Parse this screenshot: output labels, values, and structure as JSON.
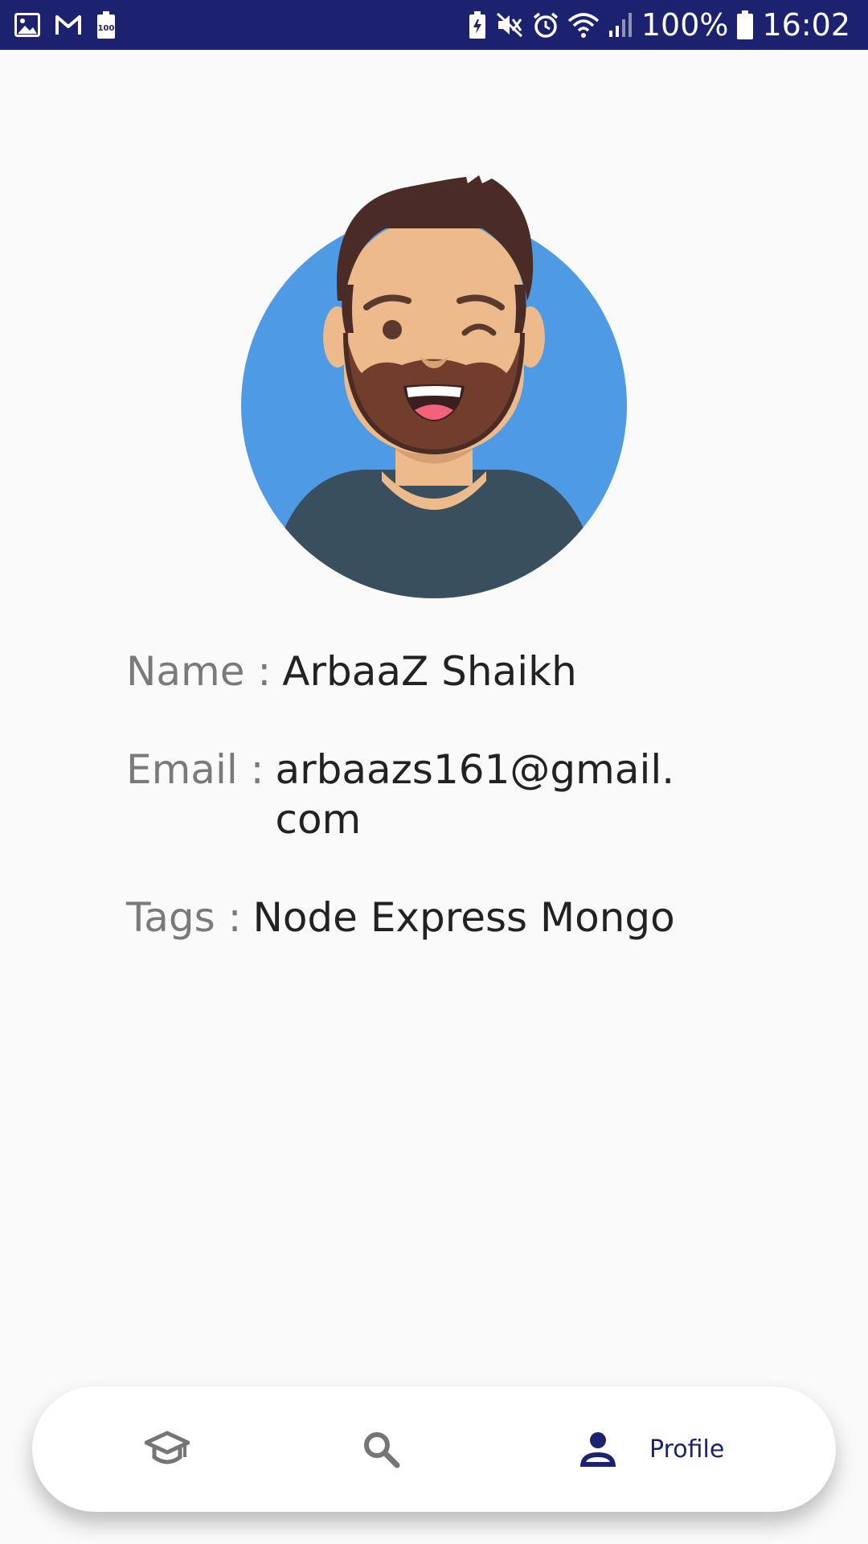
{
  "status_bar": {
    "battery_percent": "100%",
    "time": "16:02",
    "left_icons": [
      "gallery-icon",
      "gmail-icon",
      "battery-saver-100-icon"
    ],
    "right_icons": [
      "battery-charging-icon",
      "mute-icon",
      "alarm-icon",
      "wifi-icon",
      "signal-icon",
      "battery-icon"
    ]
  },
  "profile": {
    "name_label": "Name :",
    "name_value": "ArbaaZ Shaikh",
    "email_label": "Email :",
    "email_value": "arbaazs161@gmail.com",
    "tags_label": "Tags :",
    "tags_value": "Node Express Mongo"
  },
  "bottom_nav": {
    "items": [
      {
        "icon": "graduation-cap-icon",
        "label": ""
      },
      {
        "icon": "search-icon",
        "label": ""
      },
      {
        "icon": "person-icon",
        "label": "Profile"
      }
    ],
    "active": "Profile"
  },
  "colors": {
    "status_bar": "#1d2270",
    "background": "#fafafa",
    "nav_active": "#1d2270",
    "nav_inactive": "#757575",
    "avatar_bg": "#4f9ae4"
  }
}
